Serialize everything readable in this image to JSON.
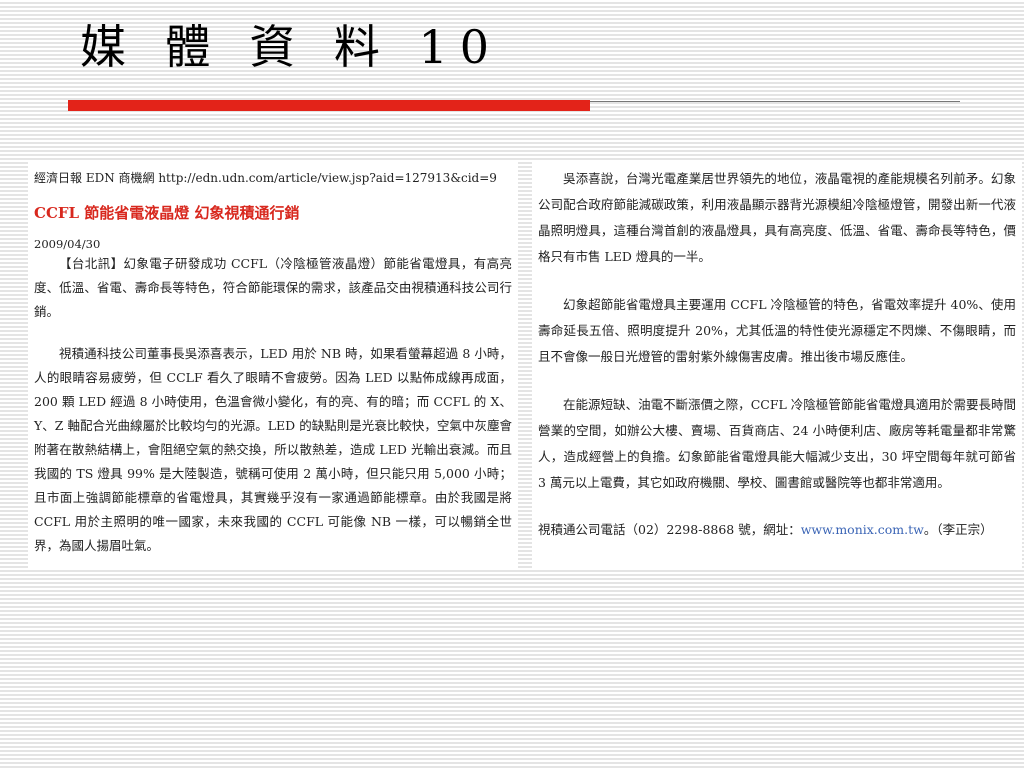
{
  "slide": {
    "title": "媒 體 資 料 10"
  },
  "left_clip": {
    "source": "經濟日報 EDN 商機網 http://edn.udn.com/article/view.jsp?aid=127913&cid=9",
    "headline": "CCFL 節能省電液晶燈  幻象視積通行銷",
    "date": "2009/04/30",
    "paragraphs": [
      "【台北訊】幻象電子研發成功 CCFL（冷陰極管液晶燈）節能省電燈具，有高亮度、低溫、省電、壽命長等特色，符合節能環保的需求，該產品交由視積通科技公司行銷。",
      "視積通科技公司董事長吳添喜表示，LED 用於 NB 時，如果看螢幕超過 8 小時，人的眼睛容易疲勞，但 CCLF 看久了眼睛不會疲勞。因為 LED 以點佈成線再成面，200 顆 LED 經過 8 小時使用，色溫會微小變化，有的亮、有的暗；而 CCFL 的 X、Y、Z 軸配合光曲線屬於比較均勻的光源。LED 的缺點則是光衰比較快，空氣中灰塵會附著在散熱結構上，會阻絕空氣的熱交換，所以散熱差，造成 LED 光輸出衰減。而且我國的 TS 燈具 99% 是大陸製造，號稱可使用 2 萬小時，但只能只用 5,000 小時；且市面上強調節能標章的省電燈具，其實幾乎沒有一家通過節能標章。由於我國是將 CCFL 用於主照明的唯一國家，未來我國的 CCFL 可能像 NB 一樣，可以暢銷全世界，為國人揚眉吐氣。"
    ]
  },
  "right_clip": {
    "paragraphs": [
      "吳添喜說，台灣光電產業居世界領先的地位，液晶電視的產能規模名列前矛。幻象公司配合政府節能減碳政策，利用液晶顯示器背光源模組冷陰極燈管，開發出新一代液晶照明燈具，這種台灣首創的液晶燈具，具有高亮度、低溫、省電、壽命長等特色，價格只有市售 LED 燈具的一半。",
      "幻象超節能省電燈具主要運用 CCFL 冷陰極管的特色，省電效率提升 40%、使用壽命延長五倍、照明度提升 20%，尤其低溫的特性使光源穩定不閃爍、不傷眼睛，而且不會像一般日光燈管的雷射紫外線傷害皮膚。推出後市場反應佳。",
      "在能源短缺、油電不斷漲價之際，CCFL 冷陰極管節能省電燈具適用於需要長時間營業的空間，如辦公大樓、賣場、百貨商店、24 小時便利店、廠房等耗電量都非常驚人，造成經營上的負擔。幻象節能省電燈具能大幅減少支出，30 坪空間每年就可節省 3 萬元以上電費，其它如政府機關、學校、圖書館或醫院等也都非常適用。"
    ],
    "contact_prefix": "視積通公司電話（02）2298-8868 號，網址：",
    "contact_url": "www.monix.com.tw",
    "contact_suffix": "。（李正宗）"
  },
  "colors": {
    "accent_red": "#e32319",
    "headline_red": "#d8281e",
    "link_blue": "#3a64b5"
  }
}
